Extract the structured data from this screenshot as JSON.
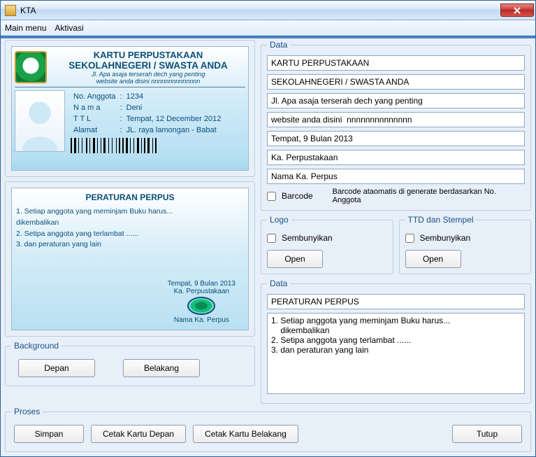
{
  "window": {
    "title": "KTA"
  },
  "menu": {
    "main": "Main menu",
    "aktivasi": "Aktivasi"
  },
  "card": {
    "title": "KARTU PERPUSTAKAAN",
    "school": "SEKOLAHNEGERI / SWASTA ANDA",
    "addr1": "Jl. Apa asaja terserah dech yang penting",
    "addr2": "website anda disini  nnnnnnnnnnnnnn",
    "fields": {
      "no_lbl": "No. Anggota",
      "no_val": "1234",
      "nama_lbl": "N a m a",
      "nama_val": "Deni",
      "ttl_lbl": "T T L",
      "ttl_val": "Tempat, 12 December 2012",
      "alamat_lbl": "Alamat",
      "alamat_val": "JL. raya lamongan - Babat"
    }
  },
  "back": {
    "title": "PERATURAN PERPUS",
    "rules": "1. Setiap anggota yang meminjam Buku harus...\n    dikembalikan\n2. Setipa anggota yang terlambat ......\n3. dan peraturan yang lain",
    "place_date": "Tempat, 9 Bulan 2013",
    "role": "Ka. Perpustakaan",
    "name": "Nama Ka. Perpus"
  },
  "groups": {
    "data": "Data",
    "logo": "Logo",
    "ttd": "TTD dan Stempel",
    "bg": "Background",
    "proses": "Proses"
  },
  "dataFields": {
    "f1": "KARTU PERPUSTAKAAN",
    "f2": "SEKOLAHNEGERI / SWASTA ANDA",
    "f3": "Jl. Apa asaja terserah dech yang penting",
    "f4": "website anda disini  nnnnnnnnnnnnnn",
    "f5": "Tempat, 9 Bulan 2013",
    "f6": "Ka. Perpustakaan",
    "f7": "Nama Ka. Perpus"
  },
  "barcode": {
    "label": "Barcode",
    "hint": "Barcode ataomatis di generate berdasarkan No. Anggota"
  },
  "logo": {
    "hide": "Sembunyikan",
    "open": "Open"
  },
  "ttd": {
    "hide": "Sembunyikan",
    "open": "Open"
  },
  "data2": {
    "title": "PERATURAN PERPUS",
    "body": "1. Setiap anggota yang meminjam Buku harus...\n    dikembalikan\n2. Setipa anggota yang terlambat ......\n3. dan peraturan yang lain"
  },
  "bg": {
    "depan": "Depan",
    "belakang": "Belakang"
  },
  "proses": {
    "simpan": "Simpan",
    "depan": "Cetak Kartu Depan",
    "belakang": "Cetak Kartu Belakang",
    "tutup": "Tutup"
  }
}
